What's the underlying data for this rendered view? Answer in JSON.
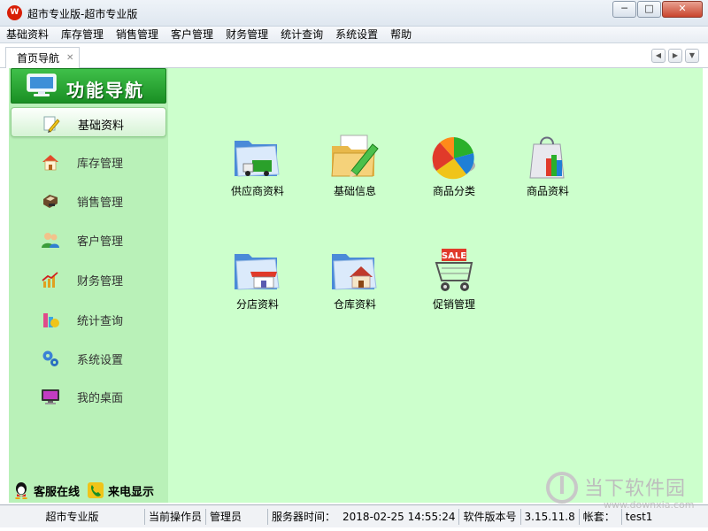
{
  "window": {
    "app_icon_text": "W",
    "title": "超市专业版-超市专业版",
    "minimize": "─",
    "maximize": "□",
    "close": "✕"
  },
  "menu": [
    "基础资料",
    "库存管理",
    "销售管理",
    "客户管理",
    "财务管理",
    "统计查询",
    "系统设置",
    "帮助"
  ],
  "tab": {
    "label": "首页导航",
    "close": "✕",
    "prev": "◀",
    "next": "▶",
    "dropdown": "▼"
  },
  "sidebar": {
    "title": "功能导航",
    "items": [
      {
        "label": "基础资料",
        "icon": "pencil-icon",
        "active": true
      },
      {
        "label": "库存管理",
        "icon": "house-icon"
      },
      {
        "label": "销售管理",
        "icon": "register-icon"
      },
      {
        "label": "客户管理",
        "icon": "users-icon"
      },
      {
        "label": "财务管理",
        "icon": "finance-chart-icon"
      },
      {
        "label": "统计查询",
        "icon": "stats-icon"
      },
      {
        "label": "系统设置",
        "icon": "gears-icon"
      },
      {
        "label": "我的桌面",
        "icon": "desktop-monitor-icon"
      }
    ],
    "footer": {
      "service": "客服在线",
      "caller": "来电显示"
    }
  },
  "modules": [
    {
      "label": "供应商资料",
      "icon": "folder-truck-icon"
    },
    {
      "label": "基础信息",
      "icon": "folder-pencil-icon"
    },
    {
      "label": "商品分类",
      "icon": "pie-chart-icon"
    },
    {
      "label": "商品资料",
      "icon": "shopping-bag-icon"
    },
    {
      "label": "分店资料",
      "icon": "folder-store-icon"
    },
    {
      "label": "仓库资料",
      "icon": "folder-house-icon"
    },
    {
      "label": "促销管理",
      "icon": "sale-cart-icon"
    }
  ],
  "status": {
    "app_name": "超市专业版",
    "operator_label": "当前操作员",
    "operator": "管理员",
    "server_time_label": "服务器时间：",
    "server_time": "2018-02-25 14:55:24",
    "version_label": "软件版本号",
    "version": "3.15.11.8",
    "account_label": "帐套：",
    "account": "test1"
  },
  "watermark": {
    "text": "当下软件园",
    "url": "www.downxia.com"
  },
  "colors": {
    "sidebar_bg": "#b9f1b8",
    "main_bg": "#ccffcc",
    "header_green": "#1a8f24"
  }
}
